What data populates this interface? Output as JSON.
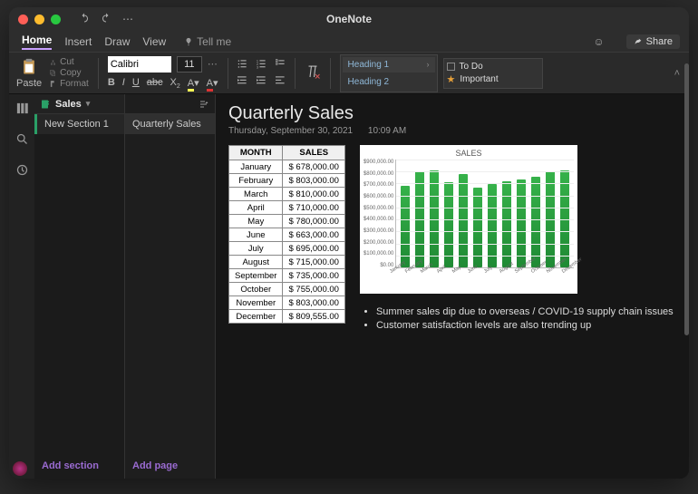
{
  "window": {
    "title": "OneNote"
  },
  "qat": {
    "undo": "undo",
    "redo": "redo"
  },
  "tabs": {
    "items": [
      "Home",
      "Insert",
      "Draw",
      "View"
    ],
    "active": 0,
    "tellme": "Tell me",
    "share": "Share"
  },
  "ribbon": {
    "paste": "Paste",
    "cut": "Cut",
    "copy": "Copy",
    "format": "Format",
    "font_name": "Calibri",
    "font_size": "11",
    "fmt": {
      "bold": "B",
      "italic": "I",
      "underline": "U",
      "strike": "abc",
      "sub": "X",
      "hilite": "▾",
      "color": "▾"
    },
    "styles": [
      {
        "label": "Heading 1",
        "selected": true
      },
      {
        "label": "Heading 2",
        "selected": false
      }
    ],
    "tags": [
      {
        "label": "To Do",
        "kind": "checkbox"
      },
      {
        "label": "Important",
        "kind": "star"
      }
    ]
  },
  "notebook": {
    "name": "Sales"
  },
  "sections": {
    "items": [
      {
        "label": "New Section 1"
      }
    ],
    "add": "Add section"
  },
  "pages": {
    "items": [
      {
        "label": "Quarterly Sales"
      }
    ],
    "add": "Add page"
  },
  "page": {
    "title": "Quarterly Sales",
    "date": "Thursday, September 30, 2021",
    "time": "10:09 AM"
  },
  "table": {
    "headers": [
      "MONTH",
      "SALES"
    ],
    "rows": [
      [
        "January",
        "$ 678,000.00"
      ],
      [
        "February",
        "$ 803,000.00"
      ],
      [
        "March",
        "$ 810,000.00"
      ],
      [
        "April",
        "$ 710,000.00"
      ],
      [
        "May",
        "$ 780,000.00"
      ],
      [
        "June",
        "$ 663,000.00"
      ],
      [
        "July",
        "$ 695,000.00"
      ],
      [
        "August",
        "$ 715,000.00"
      ],
      [
        "September",
        "$ 735,000.00"
      ],
      [
        "October",
        "$ 755,000.00"
      ],
      [
        "November",
        "$ 803,000.00"
      ],
      [
        "December",
        "$ 809,555.00"
      ]
    ]
  },
  "chart_data": {
    "type": "bar",
    "title": "SALES",
    "xlabel": "",
    "ylabel": "",
    "ylim": [
      0,
      900000
    ],
    "yticks": [
      "$900,000.00",
      "$800,000.00",
      "$700,000.00",
      "$600,000.00",
      "$500,000.00",
      "$400,000.00",
      "$300,000.00",
      "$200,000.00",
      "$100,000.00",
      "$0.00"
    ],
    "categories": [
      "January",
      "February",
      "March",
      "April",
      "May",
      "June",
      "July",
      "August",
      "September",
      "October",
      "November",
      "December"
    ],
    "values": [
      678000,
      803000,
      810000,
      710000,
      780000,
      663000,
      695000,
      715000,
      735000,
      755000,
      803000,
      809555
    ]
  },
  "notes": [
    "Summer sales dip due to overseas / COVID-19 supply chain issues",
    "Customer satisfaction levels are also trending up"
  ]
}
